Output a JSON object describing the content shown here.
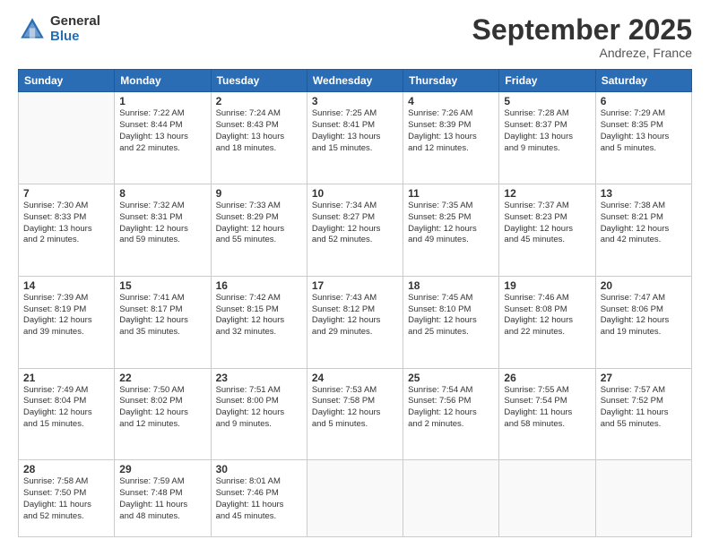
{
  "header": {
    "logo_general": "General",
    "logo_blue": "Blue",
    "month_title": "September 2025",
    "location": "Andreze, France"
  },
  "days_of_week": [
    "Sunday",
    "Monday",
    "Tuesday",
    "Wednesday",
    "Thursday",
    "Friday",
    "Saturday"
  ],
  "weeks": [
    [
      {
        "day": "",
        "info": ""
      },
      {
        "day": "1",
        "info": "Sunrise: 7:22 AM\nSunset: 8:44 PM\nDaylight: 13 hours\nand 22 minutes."
      },
      {
        "day": "2",
        "info": "Sunrise: 7:24 AM\nSunset: 8:43 PM\nDaylight: 13 hours\nand 18 minutes."
      },
      {
        "day": "3",
        "info": "Sunrise: 7:25 AM\nSunset: 8:41 PM\nDaylight: 13 hours\nand 15 minutes."
      },
      {
        "day": "4",
        "info": "Sunrise: 7:26 AM\nSunset: 8:39 PM\nDaylight: 13 hours\nand 12 minutes."
      },
      {
        "day": "5",
        "info": "Sunrise: 7:28 AM\nSunset: 8:37 PM\nDaylight: 13 hours\nand 9 minutes."
      },
      {
        "day": "6",
        "info": "Sunrise: 7:29 AM\nSunset: 8:35 PM\nDaylight: 13 hours\nand 5 minutes."
      }
    ],
    [
      {
        "day": "7",
        "info": "Sunrise: 7:30 AM\nSunset: 8:33 PM\nDaylight: 13 hours\nand 2 minutes."
      },
      {
        "day": "8",
        "info": "Sunrise: 7:32 AM\nSunset: 8:31 PM\nDaylight: 12 hours\nand 59 minutes."
      },
      {
        "day": "9",
        "info": "Sunrise: 7:33 AM\nSunset: 8:29 PM\nDaylight: 12 hours\nand 55 minutes."
      },
      {
        "day": "10",
        "info": "Sunrise: 7:34 AM\nSunset: 8:27 PM\nDaylight: 12 hours\nand 52 minutes."
      },
      {
        "day": "11",
        "info": "Sunrise: 7:35 AM\nSunset: 8:25 PM\nDaylight: 12 hours\nand 49 minutes."
      },
      {
        "day": "12",
        "info": "Sunrise: 7:37 AM\nSunset: 8:23 PM\nDaylight: 12 hours\nand 45 minutes."
      },
      {
        "day": "13",
        "info": "Sunrise: 7:38 AM\nSunset: 8:21 PM\nDaylight: 12 hours\nand 42 minutes."
      }
    ],
    [
      {
        "day": "14",
        "info": "Sunrise: 7:39 AM\nSunset: 8:19 PM\nDaylight: 12 hours\nand 39 minutes."
      },
      {
        "day": "15",
        "info": "Sunrise: 7:41 AM\nSunset: 8:17 PM\nDaylight: 12 hours\nand 35 minutes."
      },
      {
        "day": "16",
        "info": "Sunrise: 7:42 AM\nSunset: 8:15 PM\nDaylight: 12 hours\nand 32 minutes."
      },
      {
        "day": "17",
        "info": "Sunrise: 7:43 AM\nSunset: 8:12 PM\nDaylight: 12 hours\nand 29 minutes."
      },
      {
        "day": "18",
        "info": "Sunrise: 7:45 AM\nSunset: 8:10 PM\nDaylight: 12 hours\nand 25 minutes."
      },
      {
        "day": "19",
        "info": "Sunrise: 7:46 AM\nSunset: 8:08 PM\nDaylight: 12 hours\nand 22 minutes."
      },
      {
        "day": "20",
        "info": "Sunrise: 7:47 AM\nSunset: 8:06 PM\nDaylight: 12 hours\nand 19 minutes."
      }
    ],
    [
      {
        "day": "21",
        "info": "Sunrise: 7:49 AM\nSunset: 8:04 PM\nDaylight: 12 hours\nand 15 minutes."
      },
      {
        "day": "22",
        "info": "Sunrise: 7:50 AM\nSunset: 8:02 PM\nDaylight: 12 hours\nand 12 minutes."
      },
      {
        "day": "23",
        "info": "Sunrise: 7:51 AM\nSunset: 8:00 PM\nDaylight: 12 hours\nand 9 minutes."
      },
      {
        "day": "24",
        "info": "Sunrise: 7:53 AM\nSunset: 7:58 PM\nDaylight: 12 hours\nand 5 minutes."
      },
      {
        "day": "25",
        "info": "Sunrise: 7:54 AM\nSunset: 7:56 PM\nDaylight: 12 hours\nand 2 minutes."
      },
      {
        "day": "26",
        "info": "Sunrise: 7:55 AM\nSunset: 7:54 PM\nDaylight: 11 hours\nand 58 minutes."
      },
      {
        "day": "27",
        "info": "Sunrise: 7:57 AM\nSunset: 7:52 PM\nDaylight: 11 hours\nand 55 minutes."
      }
    ],
    [
      {
        "day": "28",
        "info": "Sunrise: 7:58 AM\nSunset: 7:50 PM\nDaylight: 11 hours\nand 52 minutes."
      },
      {
        "day": "29",
        "info": "Sunrise: 7:59 AM\nSunset: 7:48 PM\nDaylight: 11 hours\nand 48 minutes."
      },
      {
        "day": "30",
        "info": "Sunrise: 8:01 AM\nSunset: 7:46 PM\nDaylight: 11 hours\nand 45 minutes."
      },
      {
        "day": "",
        "info": ""
      },
      {
        "day": "",
        "info": ""
      },
      {
        "day": "",
        "info": ""
      },
      {
        "day": "",
        "info": ""
      }
    ]
  ]
}
